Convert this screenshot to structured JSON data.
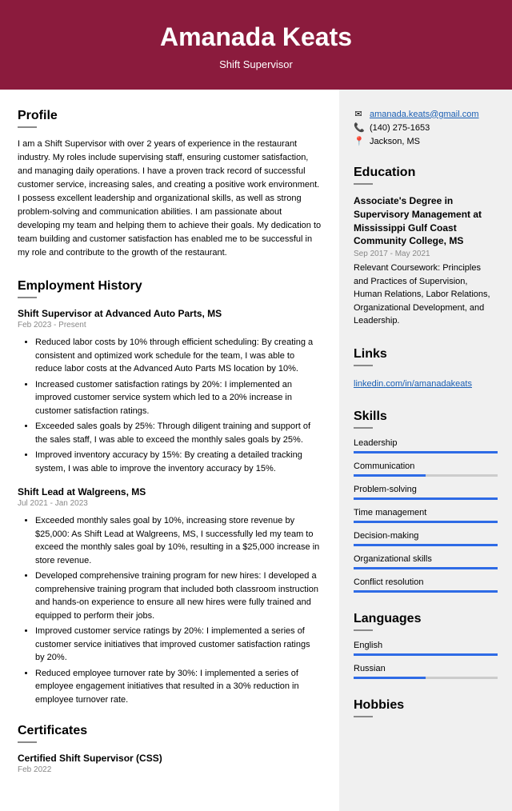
{
  "header": {
    "name": "Amanada Keats",
    "title": "Shift Supervisor"
  },
  "profile": {
    "heading": "Profile",
    "text": "I am a Shift Supervisor with over 2 years of experience in the restaurant industry. My roles include supervising staff, ensuring customer satisfaction, and managing daily operations. I have a proven track record of successful customer service, increasing sales, and creating a positive work environment. I possess excellent leadership and organizational skills, as well as strong problem-solving and communication abilities. I am passionate about developing my team and helping them to achieve their goals. My dedication to team building and customer satisfaction has enabled me to be successful in my role and contribute to the growth of the restaurant."
  },
  "employment": {
    "heading": "Employment History",
    "jobs": [
      {
        "title": "Shift Supervisor at Advanced Auto Parts, MS",
        "dates": "Feb 2023 - Present",
        "bullets": [
          "Reduced labor costs by 10% through efficient scheduling: By creating a consistent and optimized work schedule for the team, I was able to reduce labor costs at the Advanced Auto Parts MS location by 10%.",
          "Increased customer satisfaction ratings by 20%: I implemented an improved customer service system which led to a 20% increase in customer satisfaction ratings.",
          "Exceeded sales goals by 25%: Through diligent training and support of the sales staff, I was able to exceed the monthly sales goals by 25%.",
          "Improved inventory accuracy by 15%: By creating a detailed tracking system, I was able to improve the inventory accuracy by 15%."
        ]
      },
      {
        "title": "Shift Lead at Walgreens, MS",
        "dates": "Jul 2021 - Jan 2023",
        "bullets": [
          "Exceeded monthly sales goal by 10%, increasing store revenue by $25,000: As Shift Lead at Walgreens, MS, I successfully led my team to exceed the monthly sales goal by 10%, resulting in a $25,000 increase in store revenue.",
          "Developed comprehensive training program for new hires: I developed a comprehensive training program that included both classroom instruction and hands-on experience to ensure all new hires were fully trained and equipped to perform their jobs.",
          "Improved customer service ratings by 20%: I implemented a series of customer service initiatives that improved customer satisfaction ratings by 20%.",
          "Reduced employee turnover rate by 30%: I implemented a series of employee engagement initiatives that resulted in a 30% reduction in employee turnover rate."
        ]
      }
    ]
  },
  "certificates": {
    "heading": "Certificates",
    "items": [
      {
        "title": "Certified Shift Supervisor (CSS)",
        "dates": "Feb 2022"
      }
    ]
  },
  "contact": {
    "email": "amanada.keats@gmail.com",
    "phone": "(140) 275-1653",
    "location": "Jackson, MS"
  },
  "education": {
    "heading": "Education",
    "degree": "Associate's Degree in Supervisory Management at Mississippi Gulf Coast Community College, MS",
    "dates": "Sep 2017 - May 2021",
    "desc": "Relevant Coursework: Principles and Practices of Supervision, Human Relations, Labor Relations, Organizational Development, and Leadership."
  },
  "links": {
    "heading": "Links",
    "url": "linkedin.com/in/amanadakeats"
  },
  "skills": {
    "heading": "Skills",
    "items": [
      {
        "name": "Leadership",
        "level": 100
      },
      {
        "name": "Communication",
        "level": 50
      },
      {
        "name": "Problem-solving",
        "level": 100
      },
      {
        "name": "Time management",
        "level": 100
      },
      {
        "name": "Decision-making",
        "level": 100
      },
      {
        "name": "Organizational skills",
        "level": 100
      },
      {
        "name": "Conflict resolution",
        "level": 100
      }
    ]
  },
  "languages": {
    "heading": "Languages",
    "items": [
      {
        "name": "English",
        "level": 100
      },
      {
        "name": "Russian",
        "level": 50
      }
    ]
  },
  "hobbies": {
    "heading": "Hobbies"
  }
}
